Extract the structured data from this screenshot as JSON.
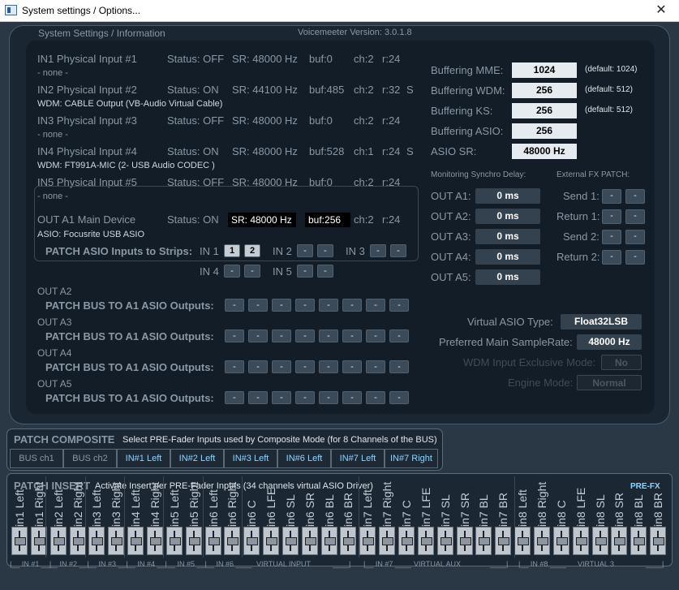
{
  "window": {
    "title": "System settings / Options...",
    "close": "✕"
  },
  "header": {
    "section": "System Settings / Information",
    "version": "Voicemeeter Version: 3.0.1.8"
  },
  "inputs": [
    {
      "name": "IN1 Physical Input #1",
      "status": "Status: OFF",
      "sr": "SR: 48000 Hz",
      "buf": "buf:0",
      "ch": "ch:2",
      "r": "r:24",
      "s": "",
      "device": "- none -"
    },
    {
      "name": "IN2 Physical Input #2",
      "status": "Status: ON",
      "sr": "SR: 44100 Hz",
      "buf": "buf:485",
      "ch": "ch:2",
      "r": "r:32",
      "s": "S",
      "device": "WDM: CABLE Output (VB-Audio Virtual Cable)"
    },
    {
      "name": "IN3 Physical Input #3",
      "status": "Status: OFF",
      "sr": "SR: 48000 Hz",
      "buf": "buf:0",
      "ch": "ch:2",
      "r": "r:24",
      "s": "",
      "device": "- none -"
    },
    {
      "name": "IN4 Physical Input #4",
      "status": "Status: ON",
      "sr": "SR: 48000 Hz",
      "buf": "buf:528",
      "ch": "ch:1",
      "r": "r:24",
      "s": "S",
      "device": "WDM: FT991A-MIC (2- USB Audio CODEC )"
    },
    {
      "name": "IN5 Physical Input #5",
      "status": "Status: OFF",
      "sr": "SR: 48000 Hz",
      "buf": "buf:0",
      "ch": "ch:2",
      "r": "r:24",
      "s": "",
      "device": "- none -"
    }
  ],
  "out_a1": {
    "name": "OUT A1 Main Device",
    "status": "Status: ON",
    "sr": "SR: 48000 Hz",
    "buf": "buf:256",
    "ch": "ch:2",
    "r": "r:24",
    "device": "ASIO: Focusrite USB ASIO",
    "patch_label": "PATCH ASIO Inputs to Strips:",
    "in1": "IN 1",
    "in2": "IN 2",
    "in3": "IN 3",
    "in4": "IN 4",
    "in5": "IN 5",
    "v1": "1",
    "v2": "2",
    "dash": "-"
  },
  "outs": [
    {
      "name": "OUT A2",
      "patch": "PATCH BUS TO A1 ASIO Outputs:"
    },
    {
      "name": "OUT A3",
      "patch": "PATCH BUS TO A1 ASIO Outputs:"
    },
    {
      "name": "OUT A4",
      "patch": "PATCH BUS TO A1 ASIO Outputs:"
    },
    {
      "name": "OUT A5",
      "patch": "PATCH BUS TO A1 ASIO Outputs:"
    }
  ],
  "buffering": [
    {
      "label": "Buffering MME:",
      "value": "1024",
      "default": "(default: 1024)"
    },
    {
      "label": "Buffering WDM:",
      "value": "256",
      "default": "(default: 512)"
    },
    {
      "label": "Buffering KS:",
      "value": "256",
      "default": "(default: 512)"
    },
    {
      "label": "Buffering ASIO:",
      "value": "256",
      "default": ""
    },
    {
      "label": "ASIO SR:",
      "value": "48000 Hz",
      "default": ""
    }
  ],
  "monitoring": {
    "title": "Monitoring Synchro Delay:",
    "rows": [
      {
        "label": "OUT A1:",
        "value": "0 ms"
      },
      {
        "label": "OUT A2:",
        "value": "0 ms"
      },
      {
        "label": "OUT A3:",
        "value": "0 ms"
      },
      {
        "label": "OUT A4:",
        "value": "0 ms"
      },
      {
        "label": "OUT A5:",
        "value": "0 ms"
      }
    ]
  },
  "external_fx": {
    "title": "External FX PATCH:",
    "rows": [
      {
        "label": "Send 1:"
      },
      {
        "label": "Return 1:"
      },
      {
        "label": "Send 2:"
      },
      {
        "label": "Return 2:"
      }
    ]
  },
  "virtual_asio": {
    "type_label": "Virtual ASIO Type:",
    "type_value": "Float32LSB",
    "sr_label": "Preferred Main SampleRate:",
    "sr_value": "48000 Hz",
    "wdm_label": "WDM Input Exclusive Mode:",
    "wdm_value": "No",
    "engine_label": "Engine Mode:",
    "engine_value": "Normal"
  },
  "composite": {
    "title": "PATCH COMPOSITE",
    "desc": "Select PRE-Fader Inputs used by Composite Mode (for 8 Channels of the BUS)",
    "buttons": [
      "BUS ch1",
      "BUS ch2",
      "IN#1 Left",
      "IN#2 Left",
      "IN#3 Left",
      "IN#6 Left",
      "IN#7 Left",
      "IN#7 Right"
    ]
  },
  "insert": {
    "title": "PATCH INSERT",
    "desc": "Activate Insert per PRE-Fader Inputs (34 channels virtual ASIO Driver)",
    "prefx": "PRE-FX",
    "channels": [
      "in1 Left",
      "in1 Right",
      "in2 Left",
      "in2 Right",
      "in3 Left",
      "in3 Right",
      "in4 Left",
      "in4 Right",
      "in5 Left",
      "in5 Right",
      "in6 Left",
      "in6 Right",
      "in6 C",
      "in6 LFE",
      "in6 SL",
      "in6 SR",
      "in6 BL",
      "in6 BR",
      "in7 Left",
      "in7 Right",
      "in7 C",
      "in7 LFE",
      "in7 SL",
      "in7 SR",
      "in7 BL",
      "in7 BR",
      "in8 Left",
      "in8 Right",
      "in8 C",
      "in8 LFE",
      "in8 SL",
      "in8 SR",
      "in8 BL",
      "in8 BR"
    ],
    "groups": [
      "|__ IN #1 __|",
      "__ IN #2 __|",
      "__ IN #3 __|",
      "__ IN #4 __|",
      "__ IN #5 __|",
      "__ IN #6 ____",
      "VIRTUAL INPUT",
      "____|",
      "|__ IN #7 ____",
      "VIRTUAL AUX",
      "____|",
      "|__ IN #8 ____",
      "VIRTUAL 3",
      "____|"
    ]
  }
}
